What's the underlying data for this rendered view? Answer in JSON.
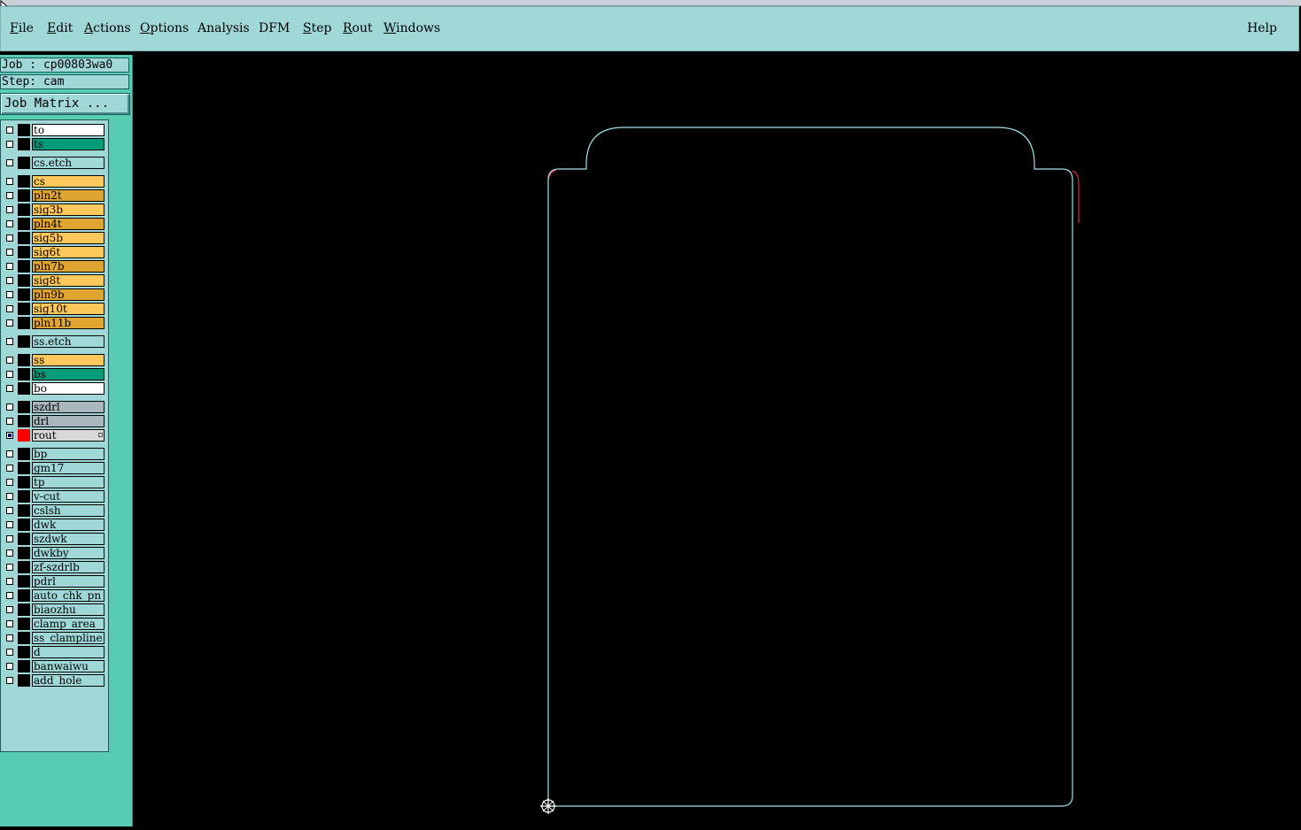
{
  "menu": {
    "items": [
      {
        "id": "file",
        "label": "File",
        "mnemonic": "F",
        "rest": "ile"
      },
      {
        "id": "edit",
        "label": "Edit",
        "mnemonic": "E",
        "rest": "dit"
      },
      {
        "id": "actions",
        "label": "Actions",
        "mnemonic": "A",
        "rest": "ctions"
      },
      {
        "id": "options",
        "label": "Options",
        "mnemonic": "O",
        "rest": "ptions"
      },
      {
        "id": "analysis",
        "label": "Analysis",
        "mnemonic": "",
        "rest": "Analysis"
      },
      {
        "id": "dfm",
        "label": "DFM",
        "mnemonic": "",
        "rest": "DFM"
      },
      {
        "id": "step",
        "label": "Step",
        "mnemonic": "S",
        "rest": "tep"
      },
      {
        "id": "rout",
        "label": "Rout",
        "mnemonic": "R",
        "rest": "out"
      },
      {
        "id": "windows",
        "label": "Windows",
        "mnemonic": "W",
        "rest": "indows"
      }
    ],
    "help": "Help"
  },
  "job": {
    "job_text": "Job : cp00803wa0",
    "step_text": "Step: cam",
    "matrix_button": "Job Matrix ..."
  },
  "layers": [
    {
      "name": "to",
      "bg": "#ffffff",
      "group": 1
    },
    {
      "name": "ts",
      "bg": "#009c7a",
      "group": 1
    },
    {
      "name": "cs.etch",
      "bg": "#a0d8d8",
      "group": 2
    },
    {
      "name": "cs",
      "bg": "#ffc85a",
      "group": 3
    },
    {
      "name": "pln2t",
      "bg": "#e0a430",
      "group": 3
    },
    {
      "name": "sig3b",
      "bg": "#ffc85a",
      "group": 3
    },
    {
      "name": "pln4t",
      "bg": "#e0a430",
      "group": 3
    },
    {
      "name": "sig5b",
      "bg": "#ffc85a",
      "group": 3
    },
    {
      "name": "sig6t",
      "bg": "#ffc85a",
      "group": 3
    },
    {
      "name": "pln7b",
      "bg": "#e0a430",
      "group": 3
    },
    {
      "name": "sig8t",
      "bg": "#ffc85a",
      "group": 3
    },
    {
      "name": "pln9b",
      "bg": "#e0a430",
      "group": 3
    },
    {
      "name": "sig10t",
      "bg": "#ffc85a",
      "group": 3
    },
    {
      "name": "pln11b",
      "bg": "#e0a430",
      "group": 3
    },
    {
      "name": "ss.etch",
      "bg": "#a0d8d8",
      "group": 4
    },
    {
      "name": "ss",
      "bg": "#ffc85a",
      "group": 5
    },
    {
      "name": "bs",
      "bg": "#009c7a",
      "group": 5
    },
    {
      "name": "bo",
      "bg": "#ffffff",
      "group": 5
    },
    {
      "name": "szdrl",
      "bg": "#a8b8bc",
      "group": 6
    },
    {
      "name": "drl",
      "bg": "#a8b8bc",
      "group": 6
    },
    {
      "name": "rout",
      "bg": "#d8d8d8",
      "group": 6,
      "active": true,
      "color": "#ff0000"
    },
    {
      "name": "bp",
      "bg": "#a0d8d8",
      "group": 7
    },
    {
      "name": "gm17",
      "bg": "#a0d8d8",
      "group": 7
    },
    {
      "name": "tp",
      "bg": "#a0d8d8",
      "group": 7
    },
    {
      "name": "v-cut",
      "bg": "#a0d8d8",
      "group": 7
    },
    {
      "name": "cslsh",
      "bg": "#a0d8d8",
      "group": 7
    },
    {
      "name": "dwk",
      "bg": "#a0d8d8",
      "group": 7
    },
    {
      "name": "szdwk",
      "bg": "#a0d8d8",
      "group": 7
    },
    {
      "name": "dwkby",
      "bg": "#a0d8d8",
      "group": 7
    },
    {
      "name": "zf-szdrlb",
      "bg": "#a0d8d8",
      "group": 7
    },
    {
      "name": "pdrl",
      "bg": "#a0d8d8",
      "group": 7
    },
    {
      "name": "auto_chk_pn",
      "bg": "#a0d8d8",
      "group": 7
    },
    {
      "name": "biaozhu",
      "bg": "#a0d8d8",
      "group": 7
    },
    {
      "name": "clamp_area",
      "bg": "#a0d8d8",
      "group": 7
    },
    {
      "name": "ss_clampline",
      "bg": "#a0d8d8",
      "group": 7
    },
    {
      "name": "d",
      "bg": "#a0d8d8",
      "group": 7
    },
    {
      "name": "banwaiwu",
      "bg": "#a0d8d8",
      "group": 7
    },
    {
      "name": "add_hole",
      "bg": "#a0d8d8",
      "group": 7
    }
  ],
  "canvas": {
    "background": "#000000",
    "outline_color": "#9fe0e8",
    "accent_color": "#ff3060"
  },
  "colors": {
    "menubar": "#a0d8d8",
    "sidebar": "#56cdb2"
  }
}
